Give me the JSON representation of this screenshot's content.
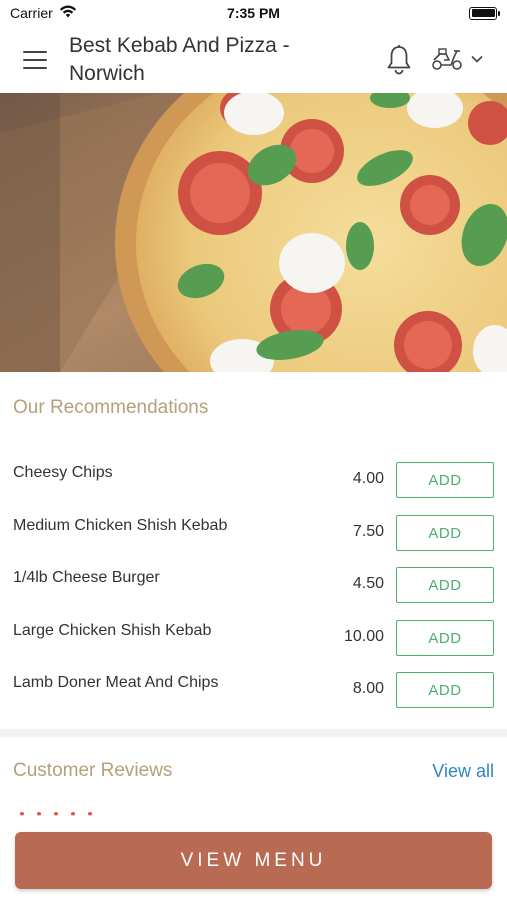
{
  "status_bar": {
    "carrier": "Carrier",
    "time": "7:35 PM",
    "battery_level": 1.0
  },
  "header": {
    "title": "Best Kebab And Pizza - Norwich"
  },
  "recommendations": {
    "title": "Our Recommendations",
    "items": [
      {
        "name": "Cheesy Chips",
        "price": "4.00",
        "add_label": "ADD"
      },
      {
        "name": "Medium Chicken Shish Kebab",
        "price": "7.50",
        "add_label": "ADD"
      },
      {
        "name": "1/4lb Cheese Burger",
        "price": "4.50",
        "add_label": "ADD"
      },
      {
        "name": "Large Chicken Shish Kebab",
        "price": "10.00",
        "add_label": "ADD"
      },
      {
        "name": "Lamb Doner Meat And Chips",
        "price": "8.00",
        "add_label": "ADD"
      }
    ]
  },
  "reviews": {
    "title": "Customer Reviews",
    "view_all": "View all"
  },
  "footer": {
    "view_menu_label": "VIEW MENU"
  },
  "colors": {
    "accent": "#b96a52",
    "add_green": "#4caf6e",
    "section_title": "#b5a07c",
    "link_blue": "#2e86c1"
  },
  "icons": [
    "wifi-icon",
    "battery-icon",
    "hamburger-menu-icon",
    "bell-icon",
    "delivery-scooter-icon",
    "chevron-down-icon"
  ]
}
